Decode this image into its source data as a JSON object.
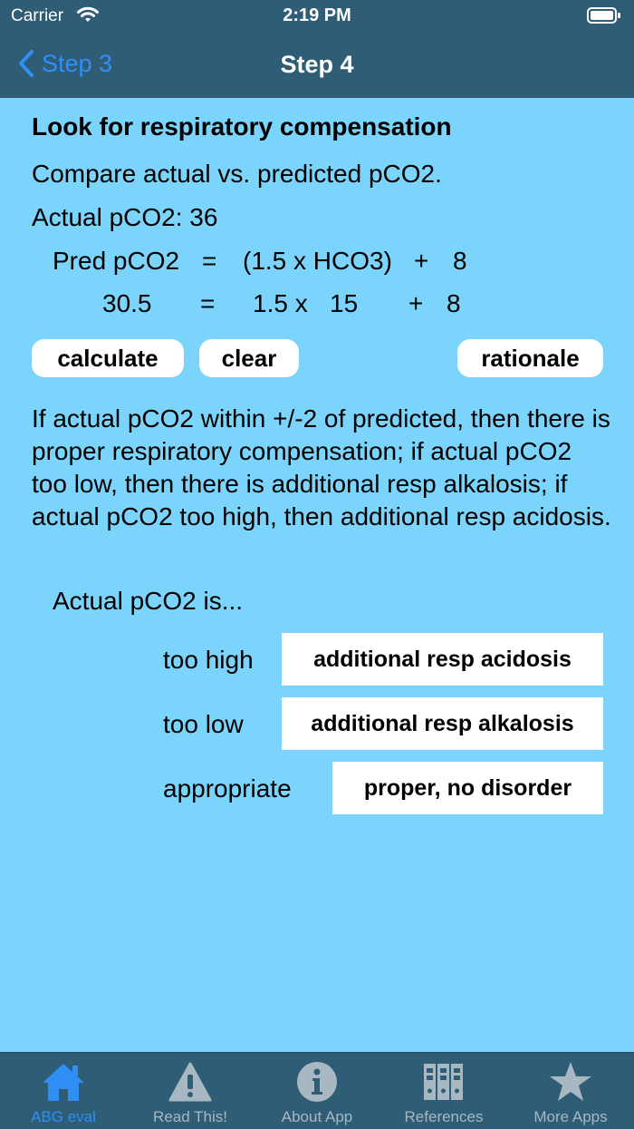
{
  "status_bar": {
    "carrier": "Carrier",
    "time": "2:19 PM"
  },
  "nav": {
    "back_label": "Step 3",
    "title": "Step 4"
  },
  "main": {
    "heading": "Look for respiratory compensation",
    "compare_text": "Compare actual vs. predicted pCO2.",
    "actual_label": "Actual pCO2: 36",
    "formula": {
      "pred_label": "Pred pCO2",
      "eq1": "=",
      "expr1": "(1.5 x HCO3)",
      "plus1": "+",
      "const1": "8",
      "value": "30.5",
      "eq2": "=",
      "coef": "1.5 x",
      "hco3": "15",
      "plus2": "+",
      "const2": "8"
    },
    "buttons": {
      "calculate": "calculate",
      "clear": "clear",
      "rationale": "rationale"
    },
    "explanation": "If actual pCO2 within +/-2 of predicted, then there is proper respiratory compensation; if actual pCO2 too low, then there is additional resp alkalosis; if actual pCO2 too high, then additional resp acidosis.",
    "question": "Actual pCO2 is...",
    "options": [
      {
        "label": "too high",
        "result": "additional resp acidosis"
      },
      {
        "label": "too low",
        "result": "additional resp alkalosis"
      },
      {
        "label": "appropriate",
        "result": "proper, no disorder"
      }
    ]
  },
  "tabs": [
    {
      "label": "ABG eval",
      "icon": "home-icon",
      "active": true
    },
    {
      "label": "Read This!",
      "icon": "warning-icon",
      "active": false
    },
    {
      "label": "About App",
      "icon": "info-icon",
      "active": false
    },
    {
      "label": "References",
      "icon": "books-icon",
      "active": false
    },
    {
      "label": "More Apps",
      "icon": "star-icon",
      "active": false
    }
  ],
  "colors": {
    "background": "#7bd4fb",
    "bar": "#2e5d75",
    "accent": "#2f8ff5",
    "inactive_tab": "#a7b8c2"
  }
}
